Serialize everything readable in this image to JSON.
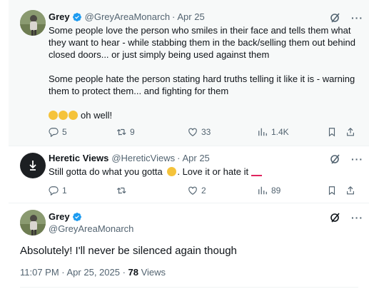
{
  "tweets": [
    {
      "name": "Grey",
      "handle": "@GreyAreaMonarch",
      "date": "Apr 25",
      "paragraph1": "Some people love the person who smiles in their face and tells them what they want to hear - while stabbing them in the back/selling them out behind closed doors... or just simply being used against them",
      "paragraph2": "Some people hate the person stating hard truths telling it like it is - warning them to protect them... and fighting for them",
      "paragraph3_text": "oh well!",
      "replies": "5",
      "reposts": "9",
      "likes": "33",
      "views": "1.4K"
    },
    {
      "name": "Heretic Views",
      "handle": "@HereticViews",
      "date": "Apr 25",
      "text_part1": "Still gotta do what you gotta",
      "text_part2": ". Love it or hate it",
      "replies": "1",
      "reposts": "",
      "likes": "2",
      "views": "89"
    }
  ],
  "main_tweet": {
    "name": "Grey",
    "handle": "@GreyAreaMonarch",
    "text": "Absolutely! I'll never be silenced again though",
    "timestamp": "11:07 PM · Apr 25, 2025 · ",
    "views_count": "78",
    "views_label": " Views"
  },
  "colors": {
    "verified": "#1d9bf0",
    "muted": "#536471",
    "highlight_bg": "#f7f9f9",
    "emoji_red": "#e0245e"
  },
  "icons": [
    "verified-badge-icon",
    "grok-icon",
    "more-icon",
    "reply-icon",
    "repost-icon",
    "like-icon",
    "views-icon",
    "bookmark-icon",
    "share-icon"
  ]
}
